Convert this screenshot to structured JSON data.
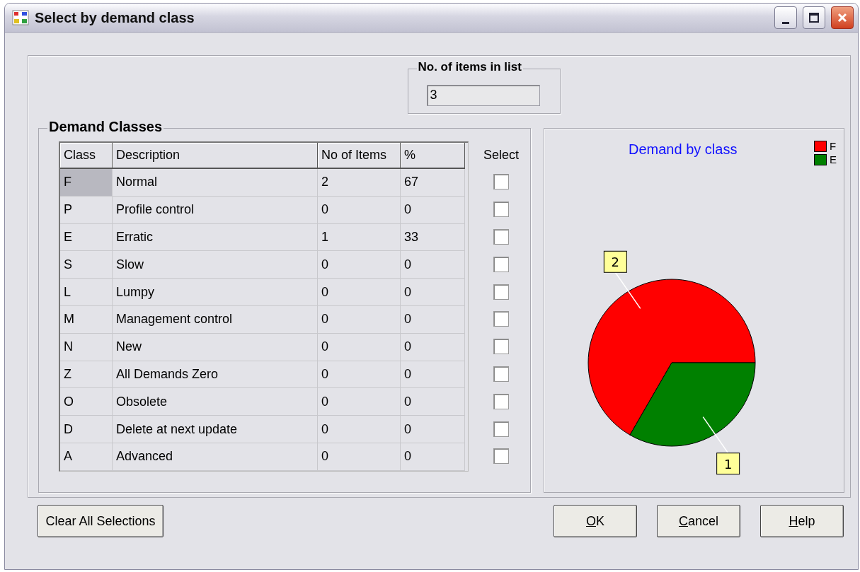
{
  "window": {
    "title": "Select by demand class"
  },
  "items_count": {
    "label": "No. of items in list",
    "value": "3"
  },
  "demand_classes": {
    "title": "Demand Classes",
    "columns": [
      "Class",
      "Description",
      "No of Items",
      "%"
    ],
    "select_label": "Select",
    "rows": [
      {
        "class": "F",
        "description": "Normal",
        "items": "2",
        "percent": "67",
        "checked": false,
        "focused": true
      },
      {
        "class": "P",
        "description": "Profile control",
        "items": "0",
        "percent": "0",
        "checked": false,
        "focused": false
      },
      {
        "class": "E",
        "description": "Erratic",
        "items": "1",
        "percent": "33",
        "checked": false,
        "focused": false
      },
      {
        "class": "S",
        "description": "Slow",
        "items": "0",
        "percent": "0",
        "checked": false,
        "focused": false
      },
      {
        "class": "L",
        "description": "Lumpy",
        "items": "0",
        "percent": "0",
        "checked": false,
        "focused": false
      },
      {
        "class": "M",
        "description": "Management control",
        "items": "0",
        "percent": "0",
        "checked": false,
        "focused": false
      },
      {
        "class": "N",
        "description": "New",
        "items": "0",
        "percent": "0",
        "checked": false,
        "focused": false
      },
      {
        "class": "Z",
        "description": "All Demands Zero",
        "items": "0",
        "percent": "0",
        "checked": false,
        "focused": false
      },
      {
        "class": "O",
        "description": "Obsolete",
        "items": "0",
        "percent": "0",
        "checked": false,
        "focused": false
      },
      {
        "class": "D",
        "description": "Delete at next update",
        "items": "0",
        "percent": "0",
        "checked": false,
        "focused": false
      },
      {
        "class": "A",
        "description": "Advanced",
        "items": "0",
        "percent": "0",
        "checked": false,
        "focused": false
      }
    ]
  },
  "chart": {
    "chart_data": {
      "type": "pie",
      "title": "Demand by class",
      "categories": [
        "F",
        "E"
      ],
      "values": [
        2,
        1
      ],
      "colors": [
        "#ff0000",
        "#008000"
      ],
      "legend": "top-right",
      "data_labels": true
    }
  },
  "buttons": {
    "clear": {
      "label": "Clear All Selections",
      "mnemonic": false
    },
    "actions": [
      {
        "label": "OK",
        "mnemonic": true
      },
      {
        "label": "Cancel",
        "mnemonic": true
      },
      {
        "label": "Help",
        "mnemonic": true
      }
    ]
  }
}
